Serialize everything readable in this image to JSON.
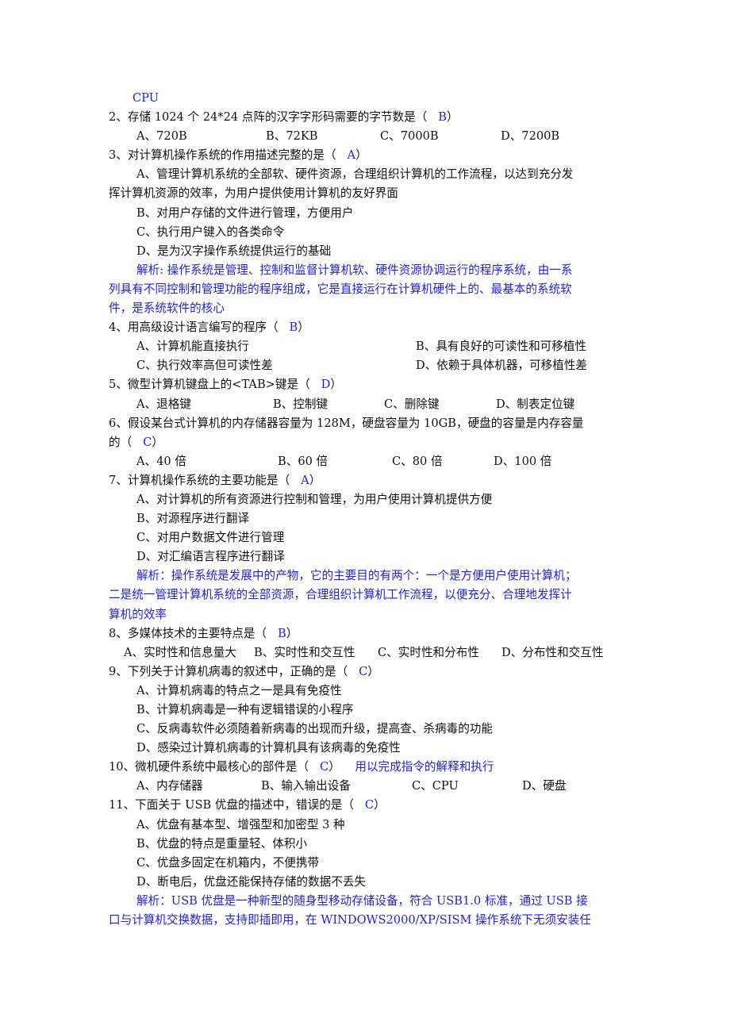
{
  "lead_fragment": "CPU",
  "questions": [
    {
      "number": "2、",
      "stem": "存储 1024 个 24*24 点阵的汉字字形码需要的字节数是（",
      "answer": "B",
      "close": "）",
      "options": [
        "A、720B",
        "B、72KB",
        "C、7000B",
        "D、7200B"
      ]
    },
    {
      "number": "3、",
      "stem": "对计算机操作系统的作用描述完整的是（",
      "answer": "A",
      "close": "）",
      "options": [
        "A、管理计算机系统的全部软、硬件资源，合理组织计算机的工作流程，以达到充分发",
        "挥计算机资源的效率，为用户提供使用计算机的友好界面",
        "B、对用户存储的文件进行管理，方便用户",
        "C、执行用户键入的各类命令",
        "D、是为汉字操作系统提供运行的基础"
      ],
      "analysis": [
        "解析: 操作系统是管理、控制和监督计算机软、硬件资源协调运行的程序系统，由一系",
        "列具有不同控制和管理功能的程序组成，它是直接运行在计算机硬件上的、最基本的系统软",
        "件，是系统软件的核心"
      ]
    },
    {
      "number": "4、",
      "stem": "用高级设计语言编写的程序（",
      "answer": "B",
      "close": "）",
      "options": [
        "A、计算机能直接执行",
        "B、具有良好的可读性和可移植性",
        "C、执行效率高但可读性差",
        "D、依赖于具体机器，可移植性差"
      ]
    },
    {
      "number": "5、",
      "stem": "微型计算机键盘上的<TAB>键是（",
      "answer": "D",
      "close": "）",
      "options": [
        "A、退格键",
        "B、控制键",
        "C、删除键",
        "D、制表定位键"
      ]
    },
    {
      "number": "6、",
      "stem": "假设某台式计算机的内存储器容量为 128M，硬盘容量为 10GB，硬盘的容量是内存容量",
      "stem_cont": "的（",
      "answer": "C",
      "close": "）",
      "options": [
        "A、40 倍",
        "B、60 倍",
        "C、80 倍",
        "D、100 倍"
      ]
    },
    {
      "number": "7、",
      "stem": "计算机操作系统的主要功能是（",
      "answer": "A",
      "close": "）",
      "options": [
        "A、对计算机的所有资源进行控制和管理，为用户使用计算机提供方便",
        "B、对源程序进行翻译",
        "C、对用户数据文件进行管理",
        "D、对汇编语言程序进行翻译"
      ],
      "analysis": [
        "解析：操作系统是发展中的产物，它的主要目的有两个：一个是方便用户使用计算机；",
        "二是统一管理计算机系统的全部资源，合理组织计算机工作流程，以便充分、合理地发挥计",
        "算机的效率"
      ]
    },
    {
      "number": "8、",
      "stem": "多媒体技术的主要特点是（",
      "answer": "B",
      "close": "）",
      "options": [
        "A、实时性和信息量大",
        "B、实时性和交互性",
        "C、实时性和分布性",
        "D、分布性和交互性"
      ]
    },
    {
      "number": "9、",
      "stem": "下列关于计算机病毒的叙述中，正确的是（",
      "answer": "C",
      "close": "）",
      "options": [
        "A、计算机病毒的特点之一是具有免疫性",
        "B、计算机病毒是一种有逻辑错误的小程序",
        "C、反病毒软件必须随着新病毒的出现而升级，提高查、杀病毒的功能",
        "D、感染过计算机病毒的计算机具有该病毒的免疫性"
      ]
    },
    {
      "number": "10、",
      "stem": "微机硬件系统中最核心的部件是（",
      "answer": "C",
      "close": "）",
      "note": "用以完成指令的解释和执行",
      "options": [
        "A、内存储器",
        "B、输入输出设备",
        "C、CPU",
        "D、硬盘"
      ]
    },
    {
      "number": "11、",
      "stem": "下面关于 USB 优盘的描述中，错误的是（",
      "answer": "C",
      "close": "）",
      "options": [
        "A、优盘有基本型、增强型和加密型 3 种",
        "B、优盘的特点是重量轻、体积小",
        "C、优盘多固定在机箱内，不便携带",
        "D、断电后，优盘还能保持存储的数据不丢失"
      ],
      "analysis": [
        "解析：USB 优盘是一种新型的随身型移动存储设备，符合 USB1.0 标准，通过 USB 接",
        "口与计算机交换数据，支持即插即用，在 WINDOWS2000/XP/SISM 操作系统下无须安装任"
      ]
    }
  ],
  "colors": {
    "text": "#111111",
    "answer_blue": "#1f1fe0"
  }
}
